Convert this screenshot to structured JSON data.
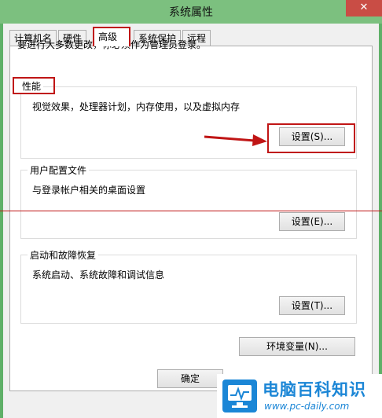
{
  "window": {
    "title": "系统属性",
    "close_glyph": "✕"
  },
  "tabs": [
    {
      "label": "计算机名",
      "active": false
    },
    {
      "label": "硬件",
      "active": false
    },
    {
      "label": "高级",
      "active": true
    },
    {
      "label": "系统保护",
      "active": false
    },
    {
      "label": "远程",
      "active": false
    }
  ],
  "admin_note": "要进行大多数更改，你必须作为管理员登录。",
  "groups": {
    "performance": {
      "title": "性能",
      "description": "视觉效果，处理器计划，内存使用，以及虚拟内存",
      "button": "设置(S)..."
    },
    "user_profiles": {
      "title": "用户配置文件",
      "description": "与登录帐户相关的桌面设置",
      "button": "设置(E)..."
    },
    "startup_recovery": {
      "title": "启动和故障恢复",
      "description": "系统启动、系统故障和调试信息",
      "button": "设置(T)..."
    }
  },
  "env_button": "环境变量(N)...",
  "ok_button": "确定",
  "watermark": {
    "title": "电脑百科知识",
    "url": "www.pc-daily.com"
  },
  "colors": {
    "annotation_red": "#c01515",
    "brand_blue": "#1b86d6"
  }
}
